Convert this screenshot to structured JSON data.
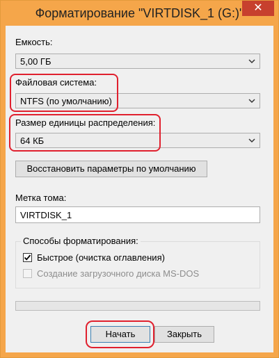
{
  "window": {
    "title": "Форматирование \"VIRTDISK_1 (G:)\"",
    "close_label": "✕"
  },
  "capacity": {
    "label": "Емкость:",
    "value": "5,00 ГБ"
  },
  "filesystem": {
    "label": "Файловая система:",
    "value": "NTFS (по умолчанию)"
  },
  "allocation": {
    "label": "Размер единицы распределения:",
    "value": "64 КБ"
  },
  "restore_defaults_label": "Восстановить параметры по умолчанию",
  "volume": {
    "label": "Метка тома:",
    "value": "VIRTDISK_1"
  },
  "format_options": {
    "title": "Способы форматирования:",
    "quick": {
      "label": "Быстрое (очистка оглавления)",
      "checked": true
    },
    "msdos": {
      "label": "Создание загрузочного диска MS-DOS",
      "checked": false,
      "enabled": false
    }
  },
  "progress_fraction": 0,
  "buttons": {
    "start": "Начать",
    "close": "Закрыть"
  },
  "colors": {
    "title_bar": "#f5a64a",
    "close_button": "#c7402e",
    "highlight": "#e0202e"
  },
  "icons": {
    "combo_arrow": "chevron-down-icon",
    "check": "checkmark-icon"
  }
}
